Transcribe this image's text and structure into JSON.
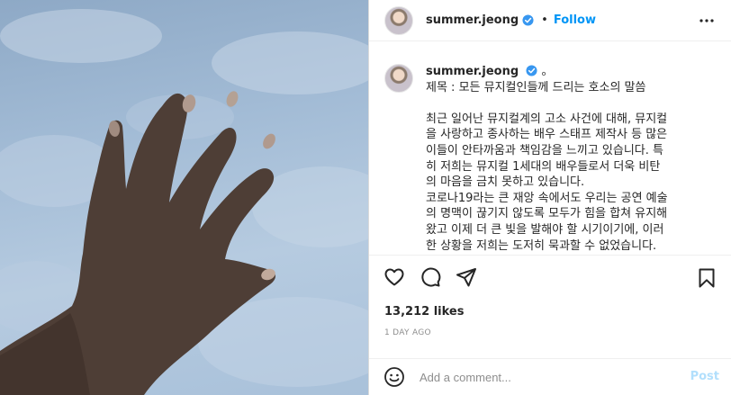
{
  "post": {
    "photo_alt": "Hand raised against a blue sky",
    "author": {
      "username": "summer.jeong",
      "verified": true,
      "avatar_icon": "profile-avatar"
    },
    "header": {
      "separator": "•",
      "follow_label": "Follow",
      "more_icon": "more-options-icon"
    },
    "caption": {
      "username": "summer.jeong",
      "suffix": "。",
      "lines": [
        "제목 : 모든 뮤지컬인들께 드리는 호소의 말씀",
        "",
        "최근 일어난 뮤지컬계의 고소 사건에 대해, 뮤지컬",
        "을 사랑하고 종사하는 배우 스태프 제작사 등 많은",
        "이들이 안타까움과 책임감을 느끼고 있습니다. 특",
        "히 저희는 뮤지컬 1세대의 배우들로서 더욱 비탄",
        "의 마음을 금치 못하고 있습니다.",
        "코로나19라는 큰 재앙 속에서도 우리는 공연 예술",
        "의 명맥이 끊기지 않도록 모두가 힘을 합쳐 유지해",
        "왔고 이제 더 큰 빛을 발해야 할 시기이기에, 이러",
        "한 상황을 저희는 도저히 묵과할 수 없었습니다."
      ]
    },
    "actions": {
      "like_icon": "heart-icon",
      "comment_icon": "comment-icon",
      "share_icon": "share-icon",
      "save_icon": "bookmark-icon"
    },
    "likes": "13,212 likes",
    "timestamp": "1 DAY AGO",
    "comment": {
      "placeholder": "Add a comment...",
      "value": "",
      "post_label": "Post",
      "emoji_icon": "emoji-icon"
    }
  },
  "colors": {
    "link_blue": "#0095f6",
    "post_disabled": "#b2dffc",
    "muted_text": "#8e8e8e",
    "border": "#efefef"
  }
}
